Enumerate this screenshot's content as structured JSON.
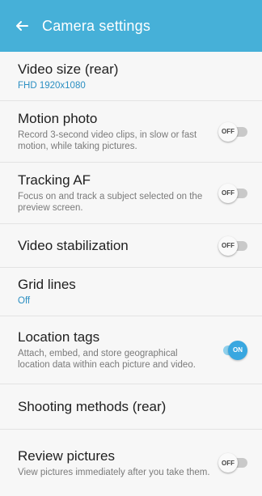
{
  "header": {
    "title": "Camera settings",
    "back_icon": "arrow-left-icon",
    "color": "#46b0d8"
  },
  "items": [
    {
      "title": "Video size (rear)",
      "value": "FHD 1920x1080"
    },
    {
      "title": "Motion photo",
      "subtitle": "Record 3-second video clips, in slow or fast motion, while taking pictures.",
      "toggle": "OFF"
    },
    {
      "title": "Tracking AF",
      "subtitle": "Focus on and track a subject selected on the preview screen.",
      "toggle": "OFF"
    },
    {
      "title": "Video stabilization",
      "toggle": "OFF"
    },
    {
      "title": "Grid lines",
      "value": "Off"
    },
    {
      "title": "Location tags",
      "subtitle": "Attach, embed, and store geographical location data within each picture and video.",
      "toggle": "ON"
    },
    {
      "title": "Shooting methods (rear)"
    },
    {
      "title": "Review pictures",
      "subtitle": "View pictures immediately after you take them.",
      "toggle": "OFF"
    }
  ],
  "colors": {
    "value_text": "#2b8fc2",
    "toggle_on": "#39a7e0"
  }
}
